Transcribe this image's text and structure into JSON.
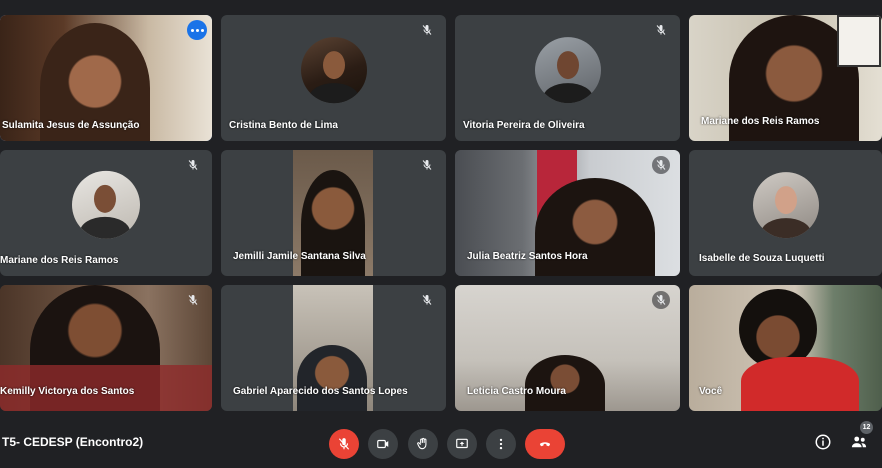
{
  "meeting": {
    "title": "T5- CEDESP (Encontro2)",
    "participant_count": "12"
  },
  "participants": [
    {
      "name": "Sulamita Jesus de Assunção",
      "mic_muted": false,
      "video": true,
      "active_speaker": true
    },
    {
      "name": "Cristina Bento de Lima",
      "mic_muted": true,
      "video": false
    },
    {
      "name": "Vitoria Pereira de Oliveira",
      "mic_muted": true,
      "video": false
    },
    {
      "name": "Mariane dos Reis Ramos",
      "mic_muted": false,
      "video": true
    },
    {
      "name": "Mariane dos Reis Ramos",
      "mic_muted": true,
      "video": false
    },
    {
      "name": "Jemilli Jamile Santana Silva",
      "mic_muted": true,
      "video": true
    },
    {
      "name": "Julia Beatriz Santos Hora",
      "mic_muted": true,
      "video": true
    },
    {
      "name": "Isabelle de Souza Luquetti",
      "mic_muted": false,
      "video": false
    },
    {
      "name": "Kemilly Victorya dos Santos",
      "mic_muted": true,
      "video": true
    },
    {
      "name": "Gabriel Aparecido dos Santos Lopes",
      "mic_muted": true,
      "video": true
    },
    {
      "name": "Leticia Castro Moura",
      "mic_muted": true,
      "video": true
    },
    {
      "name": "Você",
      "mic_muted": false,
      "video": true
    }
  ],
  "controls": {
    "mic": {
      "icon": "mic-off-icon",
      "state": "muted"
    },
    "camera": {
      "icon": "camera-icon"
    },
    "raise_hand": {
      "icon": "hand-icon"
    },
    "present": {
      "icon": "present-screen-icon"
    },
    "more": {
      "icon": "more-vert-icon"
    },
    "leave": {
      "icon": "hangup-icon"
    },
    "info": {
      "icon": "info-icon"
    },
    "people": {
      "icon": "people-icon"
    }
  },
  "colors": {
    "background": "#202124",
    "tile": "#3c4043",
    "danger": "#ea4335",
    "accent": "#1a73e8",
    "active_outline": "#8ab4f8"
  }
}
